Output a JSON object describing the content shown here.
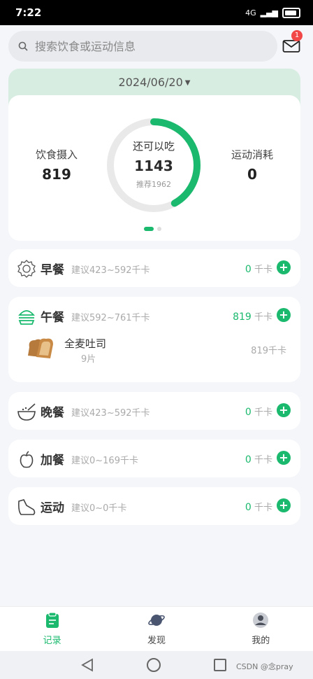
{
  "status_bar": {
    "time": "7:22",
    "network": "4G"
  },
  "search": {
    "placeholder": "搜索饮食或运动信息"
  },
  "mail": {
    "badge_count": "1"
  },
  "summary": {
    "date": "2024/06/20",
    "intake_label": "饮食摄入",
    "intake_value": "819",
    "remaining_label": "还可以吃",
    "remaining_value": "1143",
    "recommended": "推荐1962",
    "burn_label": "运动消耗",
    "burn_value": "0",
    "ring_progress": 0.42
  },
  "meals": [
    {
      "name": "早餐",
      "hint": "建议423~592千卡",
      "kcal": "0",
      "unit": "千卡",
      "icon": "sun-egg-icon"
    },
    {
      "name": "午餐",
      "hint": "建议592~761千卡",
      "kcal": "819",
      "unit": "千卡",
      "icon": "burger-icon",
      "foods": [
        {
          "name": "全麦吐司",
          "qty": "9片",
          "kcal": "819千卡"
        }
      ]
    },
    {
      "name": "晚餐",
      "hint": "建议423~592千卡",
      "kcal": "0",
      "unit": "千卡",
      "icon": "bowl-icon"
    },
    {
      "name": "加餐",
      "hint": "建议0~169千卡",
      "kcal": "0",
      "unit": "千卡",
      "icon": "apple-icon"
    },
    {
      "name": "运动",
      "hint": "建议0~0千卡",
      "kcal": "0",
      "unit": "千卡",
      "icon": "shoe-icon"
    }
  ],
  "tabs": [
    {
      "label": "记录",
      "active": true
    },
    {
      "label": "发现",
      "active": false
    },
    {
      "label": "我的",
      "active": false
    }
  ],
  "watermark": "CSDN @念pray",
  "colors": {
    "accent": "#1ab96e",
    "date_bar": "#d8ede2"
  }
}
